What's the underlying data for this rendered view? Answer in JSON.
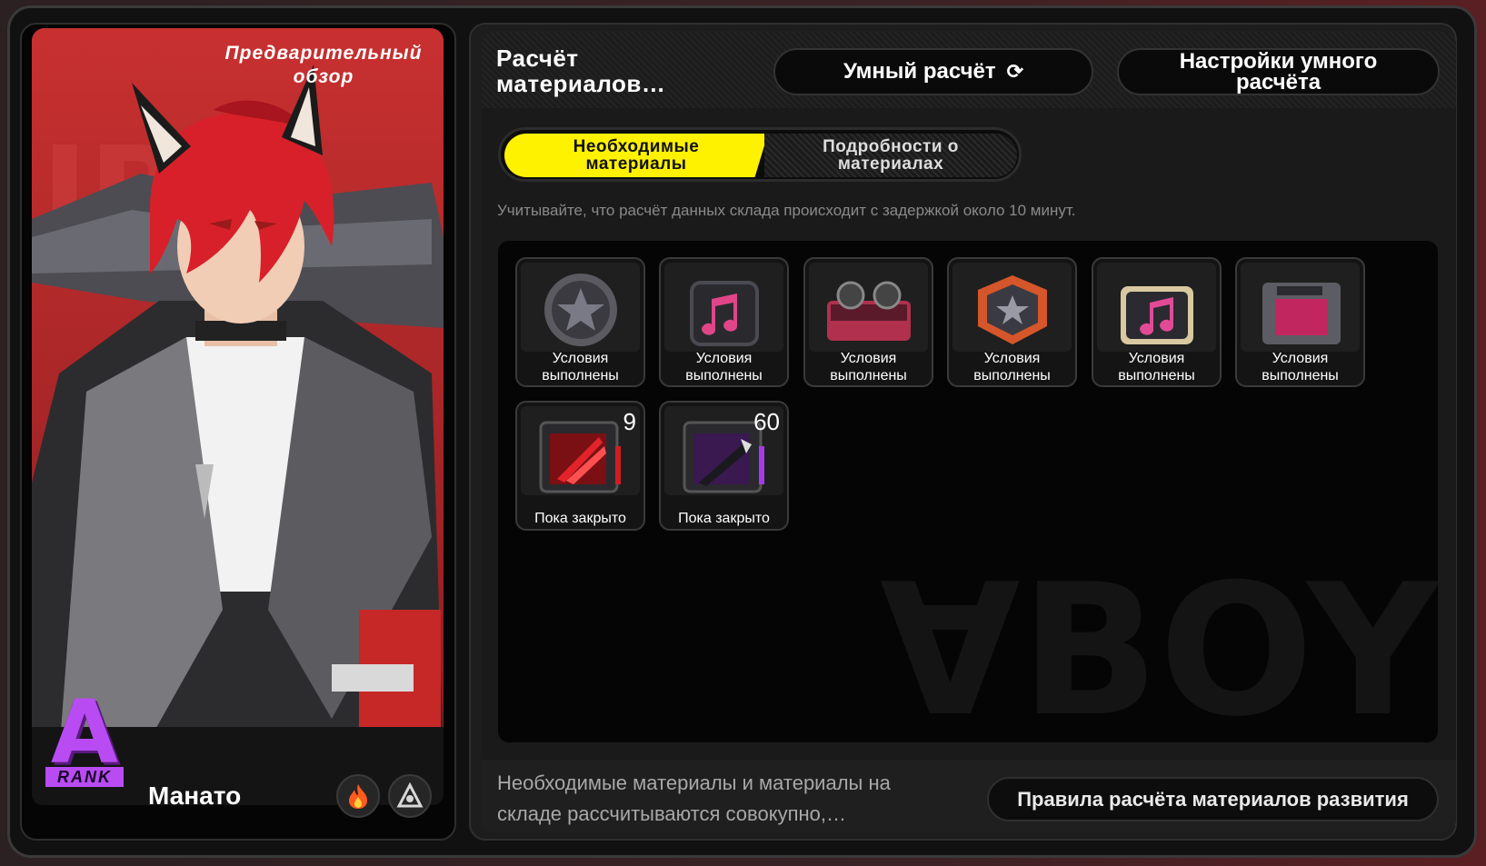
{
  "character": {
    "preview_label": "Предварительный обзор",
    "name": "Манато",
    "rank_letter": "A",
    "rank_word": "RANK",
    "attribute_icon": "fire-icon",
    "specialty_icon": "anomaly-icon"
  },
  "header": {
    "title": "Расчёт материалов…",
    "smart_calc_label": "Умный расчёт",
    "smart_settings_label": "Настройки умного расчёта"
  },
  "tabs": {
    "required": "Необходимые материалы",
    "details": "Подробности о материалах"
  },
  "note": "Учитывайте, что расчёт данных склада происходит с задержкой около 10 минут.",
  "materials": [
    {
      "status": "Условия выполнены",
      "icon": "star-coin-icon",
      "count": ""
    },
    {
      "status": "Условия выполнены",
      "icon": "pink-note-chip-icon",
      "count": ""
    },
    {
      "status": "Условия выполнены",
      "icon": "tape-recorder-icon",
      "count": ""
    },
    {
      "status": "Условия выполнены",
      "icon": "orange-badge-icon",
      "count": ""
    },
    {
      "status": "Условия выполнены",
      "icon": "disc-note-icon",
      "count": ""
    },
    {
      "status": "Условия выполнены",
      "icon": "floppy-module-icon",
      "count": ""
    },
    {
      "status": "Пока закрыто",
      "icon": "red-claw-chip-icon",
      "count": "9"
    },
    {
      "status": "Пока закрыто",
      "icon": "purple-blade-chip-icon",
      "count": "60"
    }
  ],
  "footer": {
    "text": "Необходимые материалы и материалы на складе рассчитываются совокупно,…",
    "rules_button": "Правила расчёта материалов развития"
  },
  "colors": {
    "accent": "#fff200",
    "rank": "#b84cf2",
    "card_red": "#c72f2f"
  }
}
